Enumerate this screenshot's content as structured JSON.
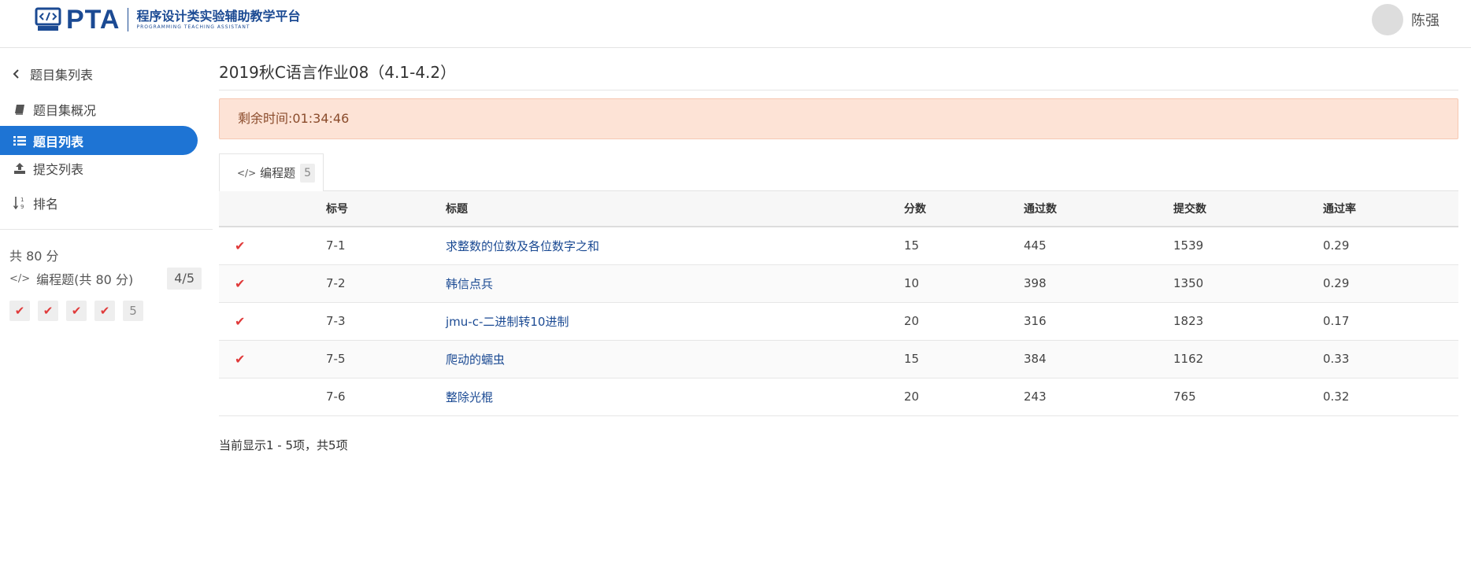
{
  "header": {
    "logo_text": "PTA",
    "logo_cn": "程序设计类实验辅助教学平台",
    "logo_en": "PROGRAMMING TEACHING ASSISTANT",
    "user_name": "陈强"
  },
  "sidebar": {
    "back_label": "题目集列表",
    "items": [
      {
        "label": "题目集概况",
        "icon": "book-icon"
      },
      {
        "label": "题目列表",
        "icon": "list-icon",
        "active": true
      },
      {
        "label": "提交列表",
        "icon": "upload-icon"
      },
      {
        "label": "排名",
        "icon": "sort-numeric-icon"
      }
    ],
    "score_total": "共 80 分",
    "category_label": "编程题(共 80 分)",
    "category_progress": "4/5",
    "progress_items": [
      "✔",
      "✔",
      "✔",
      "✔",
      "5"
    ]
  },
  "main": {
    "title": "2019秋C语言作业08（4.1-4.2）",
    "timer": "剩余时间:01:34:46",
    "tab_label": "编程题",
    "tab_count": "5",
    "table": {
      "headers": [
        "",
        "标号",
        "标题",
        "分数",
        "通过数",
        "提交数",
        "通过率"
      ],
      "rows": [
        {
          "passed": true,
          "mark": "✔",
          "no": "7-1",
          "title": "求整数的位数及各位数字之和",
          "score": "15",
          "pass": "445",
          "submit": "1539",
          "rate": "0.29"
        },
        {
          "passed": true,
          "mark": "✔",
          "no": "7-2",
          "title": "韩信点兵",
          "score": "10",
          "pass": "398",
          "submit": "1350",
          "rate": "0.29"
        },
        {
          "passed": true,
          "mark": "✔",
          "no": "7-3",
          "title": "jmu-c-二进制转10进制",
          "score": "20",
          "pass": "316",
          "submit": "1823",
          "rate": "0.17"
        },
        {
          "passed": true,
          "mark": "✔",
          "no": "7-5",
          "title": "爬动的蠕虫",
          "score": "15",
          "pass": "384",
          "submit": "1162",
          "rate": "0.33"
        },
        {
          "passed": false,
          "mark": "",
          "no": "7-6",
          "title": "整除光棍",
          "score": "20",
          "pass": "243",
          "submit": "765",
          "rate": "0.32"
        }
      ]
    },
    "footer_info": "当前显示1 - 5项，共5项"
  },
  "colors": {
    "brand": "#1b4a93",
    "active_nav": "#1e74d4",
    "timer_bg": "#fde3d6",
    "check": "#e03a3a",
    "link": "#1b4a93"
  }
}
